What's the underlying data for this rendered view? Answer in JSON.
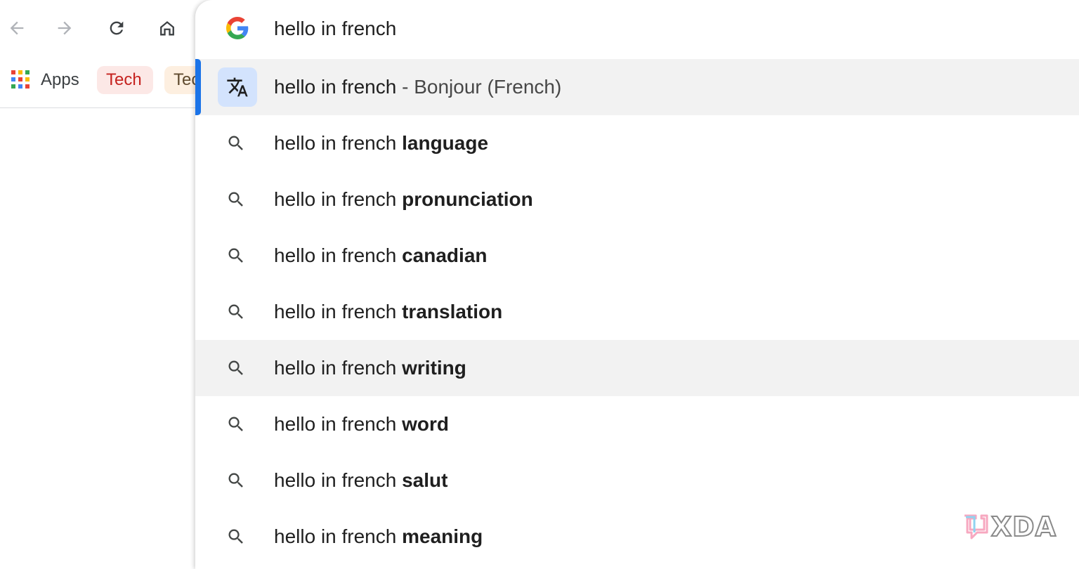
{
  "toolbar": {
    "back_icon": "arrow-left-icon",
    "forward_icon": "arrow-right-icon",
    "reload_icon": "reload-icon",
    "home_icon": "home-icon"
  },
  "bookmarks": {
    "apps_label": "Apps",
    "items": [
      {
        "label": "Tech",
        "bg": "#fce8e6",
        "color": "#c5221f"
      },
      {
        "label": "Tech",
        "bg": "#fdefe0",
        "color": "#5f4a2e"
      }
    ]
  },
  "omnibox": {
    "query": "hello in french",
    "engine_icon": "google-g-icon",
    "answer": {
      "query": "hello in french",
      "result": "- Bonjour (French)",
      "icon": "translate-icon"
    },
    "suggestions": [
      {
        "prefix": "hello in french ",
        "completion": "language"
      },
      {
        "prefix": "hello in french ",
        "completion": "pronunciation"
      },
      {
        "prefix": "hello in french ",
        "completion": "canadian"
      },
      {
        "prefix": "hello in french ",
        "completion": "translation"
      },
      {
        "prefix": "hello in french ",
        "completion": "writing"
      },
      {
        "prefix": "hello in french ",
        "completion": "word"
      },
      {
        "prefix": "hello in french ",
        "completion": "salut"
      },
      {
        "prefix": "hello in french ",
        "completion": "meaning"
      }
    ]
  },
  "watermark": {
    "text": "XDA"
  },
  "colors": {
    "accent": "#1a73e8",
    "hover_row": "#f2f2f2",
    "translate_tile": "#d3e3fd"
  }
}
